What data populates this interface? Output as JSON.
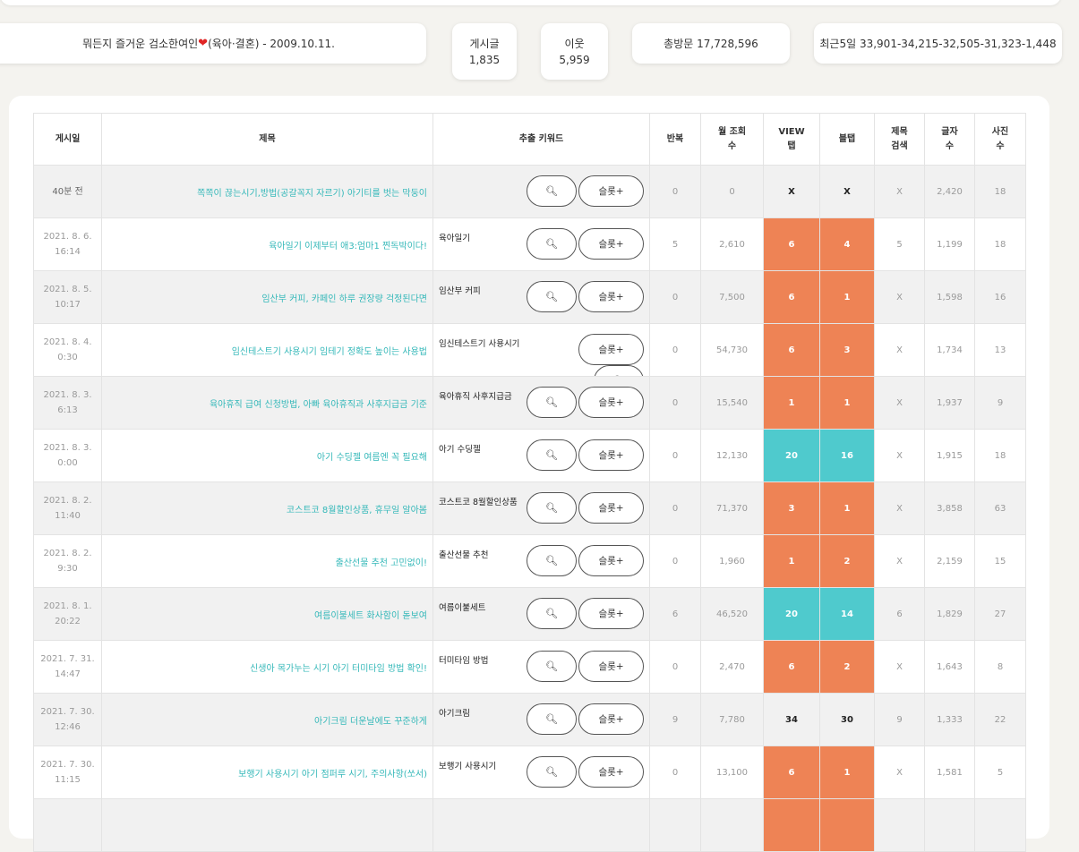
{
  "stats": {
    "blog_title": "뭐든지 즐거운 검소한여인",
    "blog_subtitle": "(육아·결혼) - 2009.10.11.",
    "posts_label": "게시글",
    "posts_value": "1,835",
    "neighbors_label": "이웃",
    "neighbors_value": "5,959",
    "total_visits": "총방문 17,728,596",
    "recent5": "최근5일 33,901-34,215-32,505-31,323-1,448"
  },
  "table": {
    "headers": {
      "date": "게시일",
      "title": "제목",
      "keyword": "추출 키워드",
      "repeat": "반복",
      "monthly_line1": "월 조회",
      "monthly_line2": "수",
      "view_line1": "VIEW",
      "view_line2": "탭",
      "blog_tab": "블탭",
      "title_search_line1": "제목",
      "title_search_line2": "검색",
      "chars_line1": "글자",
      "chars_line2": "수",
      "photos_line1": "사진",
      "photos_line2": "수"
    },
    "slot_label": "슬롯+",
    "rows": [
      {
        "date1": "40분 전",
        "date2": "",
        "title": "쪽쪽이 끊는시기,방법(공갈꼭지 자르기) 아기티를 벗는 막둥이",
        "keyword": "",
        "repeat": "0",
        "monthly": "0",
        "view": "X",
        "blog": "X",
        "tsearch": "X",
        "chars": "2,420",
        "photos": "18",
        "view_style": "bold",
        "blog_style": "bold"
      },
      {
        "date1": "2021. 8. 6.",
        "date2": "16:14",
        "title": "육아일기 이제부터 애3:엄마1 찐독박이다!",
        "keyword": "육아일기",
        "repeat": "5",
        "monthly": "2,610",
        "view": "6",
        "blog": "4",
        "tsearch": "5",
        "chars": "1,199",
        "photos": "18",
        "view_style": "orange",
        "blog_style": "orange"
      },
      {
        "date1": "2021. 8. 5.",
        "date2": "10:17",
        "title": "임산부 커피, 카페인 하루 권장량 걱정된다면",
        "keyword": "임산부 커피",
        "repeat": "0",
        "monthly": "7,500",
        "view": "6",
        "blog": "1",
        "tsearch": "X",
        "chars": "1,598",
        "photos": "16",
        "view_style": "orange",
        "blog_style": "orange"
      },
      {
        "date1": "2021. 8. 4.",
        "date2": "0:30",
        "title": "임신테스트기 사용시기 임테기 정확도 높이는 사용법",
        "keyword": "임신테스트기 사용시기",
        "repeat": "0",
        "monthly": "54,730",
        "view": "6",
        "blog": "3",
        "tsearch": "X",
        "chars": "1,734",
        "photos": "13",
        "view_style": "orange",
        "blog_style": "orange",
        "stacked": true
      },
      {
        "date1": "2021. 8. 3.",
        "date2": "6:13",
        "title": "육아휴직 급여 신청방법, 아빠 육아휴직과 사후지급금 기준",
        "keyword": "육아휴직 사후지급금",
        "repeat": "0",
        "monthly": "15,540",
        "view": "1",
        "blog": "1",
        "tsearch": "X",
        "chars": "1,937",
        "photos": "9",
        "view_style": "orange",
        "blog_style": "orange"
      },
      {
        "date1": "2021. 8. 3.",
        "date2": "0:00",
        "title": "아기 수딩젤 여름엔 꼭 필요해",
        "keyword": "아기 수딩젤",
        "repeat": "0",
        "monthly": "12,130",
        "view": "20",
        "blog": "16",
        "tsearch": "X",
        "chars": "1,915",
        "photos": "18",
        "view_style": "teal",
        "blog_style": "teal"
      },
      {
        "date1": "2021. 8. 2.",
        "date2": "11:40",
        "title": "코스트코 8월할인상품, 휴무일 알아봄",
        "keyword": "코스트코 8월할인상품",
        "repeat": "0",
        "monthly": "71,370",
        "view": "3",
        "blog": "1",
        "tsearch": "X",
        "chars": "3,858",
        "photos": "63",
        "view_style": "orange",
        "blog_style": "orange"
      },
      {
        "date1": "2021. 8. 2.",
        "date2": "9:30",
        "title": "출산선물 추천 고민없이!",
        "keyword": "출산선물 추천",
        "repeat": "0",
        "monthly": "1,960",
        "view": "1",
        "blog": "2",
        "tsearch": "X",
        "chars": "2,159",
        "photos": "15",
        "view_style": "orange",
        "blog_style": "orange"
      },
      {
        "date1": "2021. 8. 1.",
        "date2": "20:22",
        "title": "여름이불세트 화사함이 돋보여",
        "keyword": "여름이불세트",
        "repeat": "6",
        "monthly": "46,520",
        "view": "20",
        "blog": "14",
        "tsearch": "6",
        "chars": "1,829",
        "photos": "27",
        "view_style": "teal",
        "blog_style": "teal"
      },
      {
        "date1": "2021. 7. 31.",
        "date2": "14:47",
        "title": "신생아 목가누는 시기 아기 터미타임 방법 확인!",
        "keyword": "터미타임 방법",
        "repeat": "0",
        "monthly": "2,470",
        "view": "6",
        "blog": "2",
        "tsearch": "X",
        "chars": "1,643",
        "photos": "8",
        "view_style": "orange",
        "blog_style": "orange"
      },
      {
        "date1": "2021. 7. 30.",
        "date2": "12:46",
        "title": "아기크림 더운날에도 꾸준하게",
        "keyword": "아기크림",
        "repeat": "9",
        "monthly": "7,780",
        "view": "34",
        "blog": "30",
        "tsearch": "9",
        "chars": "1,333",
        "photos": "22",
        "view_style": "bold",
        "blog_style": "bold"
      },
      {
        "date1": "2021. 7. 30.",
        "date2": "11:15",
        "title": "보행기 사용시기 아기 점퍼루 시기, 주의사항(쏘서)",
        "keyword": "보행기 사용시기",
        "repeat": "0",
        "monthly": "13,100",
        "view": "6",
        "blog": "1",
        "tsearch": "X",
        "chars": "1,581",
        "photos": "5",
        "view_style": "orange",
        "blog_style": "orange"
      },
      {
        "date1": "",
        "date2": "",
        "title": "",
        "keyword": "",
        "repeat": "",
        "monthly": "",
        "view": "",
        "blog": "",
        "tsearch": "",
        "chars": "",
        "photos": "",
        "view_style": "orange",
        "blog_style": "orange",
        "partial": true
      }
    ]
  }
}
